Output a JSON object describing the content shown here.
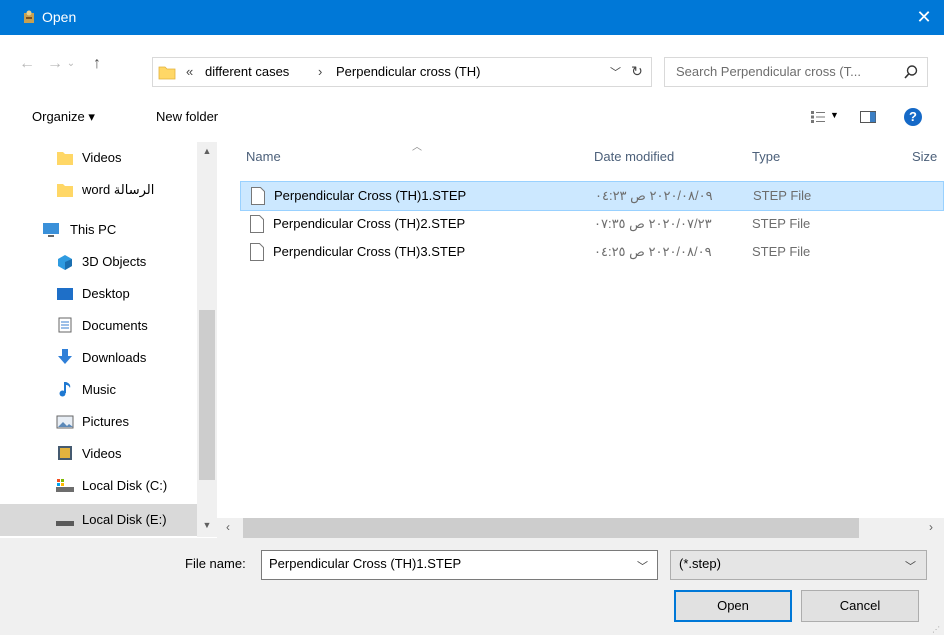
{
  "window": {
    "title": "Open",
    "close_label": "✕"
  },
  "address": {
    "overflow": "«",
    "crumbs": [
      "different cases",
      "Perpendicular cross (TH)"
    ],
    "separator": "›",
    "search_placeholder": "Search Perpendicular cross (T..."
  },
  "toolbar": {
    "organize": "Organize ▾",
    "new_folder": "New folder",
    "help": "?"
  },
  "nav": {
    "items": [
      {
        "label": "Videos",
        "icon": "folder-icon"
      },
      {
        "label": "word الرسالة",
        "icon": "folder-icon"
      },
      {
        "label": "This PC",
        "icon": "computer-icon"
      },
      {
        "label": "3D Objects",
        "icon": "cube-icon"
      },
      {
        "label": "Desktop",
        "icon": "desktop-icon"
      },
      {
        "label": "Documents",
        "icon": "documents-icon"
      },
      {
        "label": "Downloads",
        "icon": "download-icon"
      },
      {
        "label": "Music",
        "icon": "music-icon"
      },
      {
        "label": "Pictures",
        "icon": "pictures-icon"
      },
      {
        "label": "Videos",
        "icon": "videos-icon"
      },
      {
        "label": "Local Disk (C:)",
        "icon": "drive-icon"
      },
      {
        "label": "Local Disk (E:)",
        "icon": "drive-icon"
      }
    ]
  },
  "columns": {
    "name": "Name",
    "date": "Date modified",
    "type": "Type",
    "size": "Size"
  },
  "files": [
    {
      "name": "Perpendicular Cross (TH)1.STEP",
      "date": "٢٠٢٠/٠٨/٠٩ ص ٠٤:٢٣",
      "type": "STEP File",
      "selected": true
    },
    {
      "name": "Perpendicular Cross (TH)2.STEP",
      "date": "٢٠٢٠/٠٧/٢٣ ص ٠٧:٣٥",
      "type": "STEP File",
      "selected": false
    },
    {
      "name": "Perpendicular Cross (TH)3.STEP",
      "date": "٢٠٢٠/٠٨/٠٩ ص ٠٤:٢٥",
      "type": "STEP File",
      "selected": false
    }
  ],
  "bottom": {
    "file_name_label": "File name:",
    "file_name_value": "Perpendicular Cross (TH)1.STEP",
    "filter_value": "(*.step)",
    "open_label": "Open",
    "cancel_label": "Cancel"
  },
  "colors": {
    "accent": "#0078d7",
    "selection": "#cce8ff",
    "folder": "#ffd766"
  }
}
